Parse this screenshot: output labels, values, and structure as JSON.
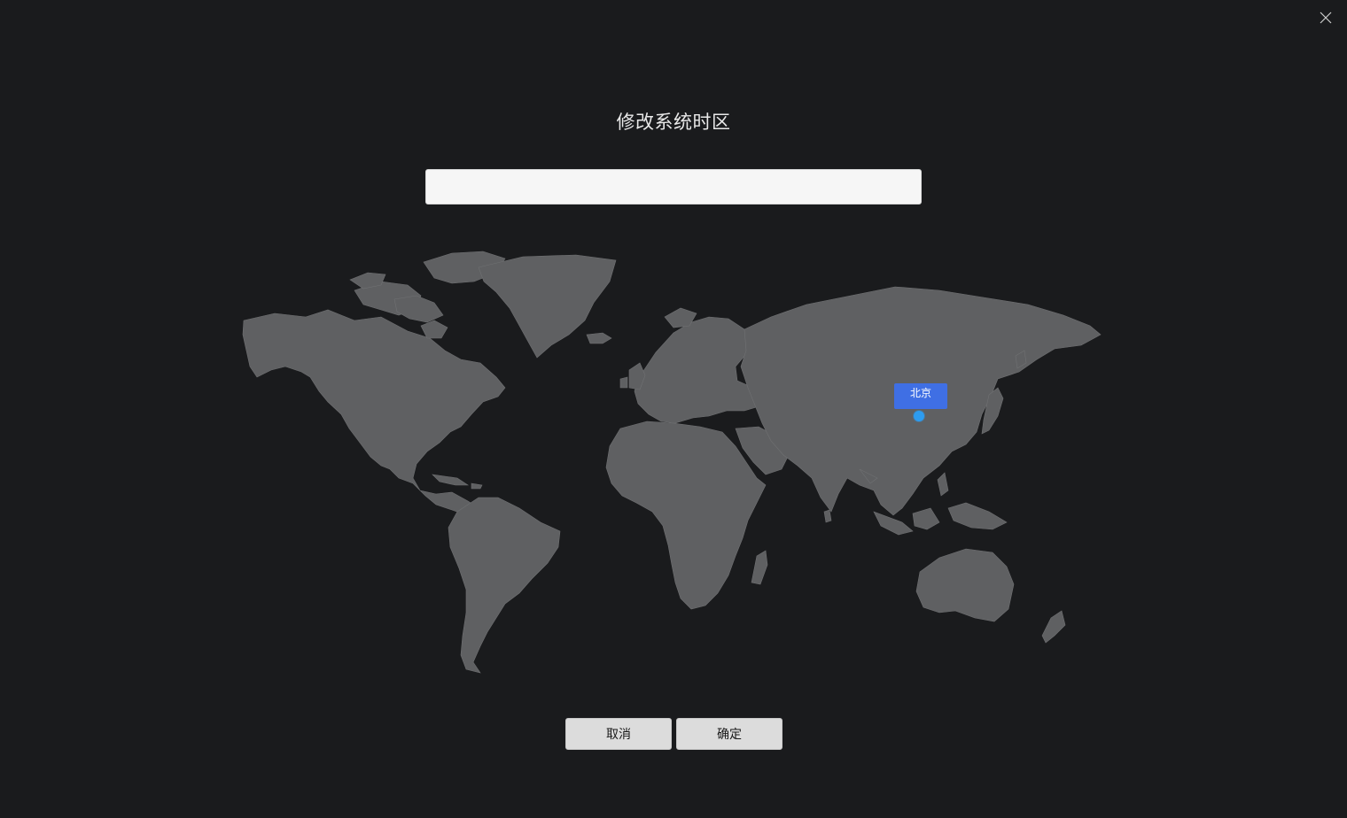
{
  "dialog": {
    "title": "修改系统时区",
    "close_icon": "close-icon"
  },
  "search": {
    "value": "",
    "placeholder": ""
  },
  "map": {
    "land_color": "#5f6062",
    "border_color": "#707173",
    "selected_timezone_label": "北京",
    "label_color": "#3f6fe4",
    "dot_color": "#2d9cf0"
  },
  "buttons": {
    "cancel_label": "取消",
    "confirm_label": "确定"
  }
}
